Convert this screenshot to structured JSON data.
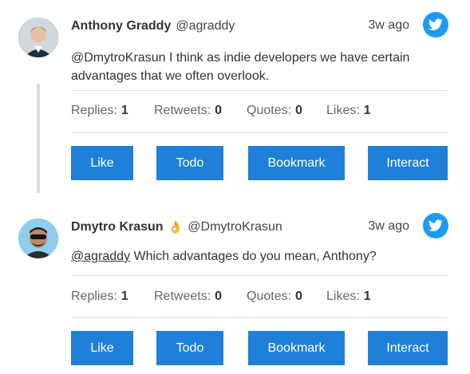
{
  "tweets": [
    {
      "author_name": "Anthony Graddy",
      "author_emoji": "",
      "handle": "@agraddy",
      "time": "3w ago",
      "mention": "",
      "text": "@DmytroKrasun I think as indie developers we have certain advantages that we often overlook.",
      "stats": {
        "replies_label": "Replies:",
        "replies": "1",
        "retweets_label": "Retweets:",
        "retweets": "0",
        "quotes_label": "Quotes:",
        "quotes": "0",
        "likes_label": "Likes:",
        "likes": "1"
      },
      "buttons": {
        "like": "Like",
        "todo": "Todo",
        "bookmark": "Bookmark",
        "interact": "Interact"
      }
    },
    {
      "author_name": "Dmytro Krasun",
      "author_emoji": "👌",
      "handle": "@DmytroKrasun",
      "time": "3w ago",
      "mention": "@agraddy",
      "text": " Which advantages do you mean, Anthony?",
      "stats": {
        "replies_label": "Replies:",
        "replies": "1",
        "retweets_label": "Retweets:",
        "retweets": "0",
        "quotes_label": "Quotes:",
        "quotes": "0",
        "likes_label": "Likes:",
        "likes": "1"
      },
      "buttons": {
        "like": "Like",
        "todo": "Todo",
        "bookmark": "Bookmark",
        "interact": "Interact"
      }
    }
  ],
  "icons": {
    "service": "twitter-bird-icon"
  },
  "colors": {
    "accent": "#1f80d9",
    "twitter": "#1d9bf0"
  }
}
